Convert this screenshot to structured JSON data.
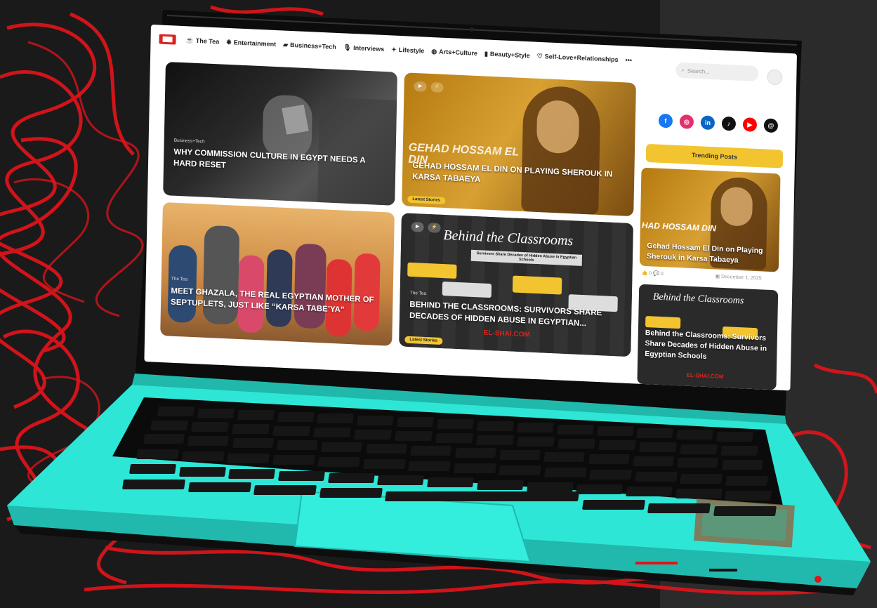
{
  "nav": {
    "items": [
      {
        "icon": "mug-icon",
        "glyph": "☕",
        "label": "The Tea"
      },
      {
        "icon": "theater-icon",
        "glyph": "✱",
        "label": "Entertainment"
      },
      {
        "icon": "briefcase-icon",
        "glyph": "▰",
        "label": "Business+Tech"
      },
      {
        "icon": "microphone-icon",
        "glyph": "🎙",
        "label": "Interviews"
      },
      {
        "icon": "sparkle-icon",
        "glyph": "✦",
        "label": "Lifestyle"
      },
      {
        "icon": "palette-icon",
        "glyph": "◍",
        "label": "Arts+Culture"
      },
      {
        "icon": "lipstick-icon",
        "glyph": "▮",
        "label": "Beauty+Style"
      },
      {
        "icon": "heart-icon",
        "glyph": "♡",
        "label": "Self-Love+Relationships"
      }
    ],
    "more": "•••",
    "search_placeholder": "Search..."
  },
  "cards": {
    "c1": {
      "category": "Business+Tech",
      "title": "WHY COMMISSION CULTURE IN EGYPT NEEDS A HARD RESET"
    },
    "c2": {
      "overlay": "GEHAD HOSSAM EL DIN",
      "title": "GEHAD HOSSAM EL DIN ON PLAYING SHEROUK IN KARSA TABAEYA",
      "tag": "Latest Stories"
    },
    "c3": {
      "category": "The Tea",
      "title": "MEET GHAZALA, THE REAL EGYPTIAN MOTHER OF SEPTUPLETS, JUST LIKE “KARSA TABE’YA”"
    },
    "c4": {
      "poster_title": "Behind the Classrooms",
      "poster_sub": "Survivors Share Decades of Hidden Abuse in Egyptian Schools",
      "category": "The Tea",
      "title": "BEHIND THE CLASSROOMS: SURVIVORS SHARE DECADES OF HIDDEN ABUSE IN EGYPTIAN...",
      "tag": "Latest Stories",
      "brand": "EL-SHAI.COM"
    }
  },
  "sidebar": {
    "socials": [
      {
        "icon": "facebook-icon",
        "glyph": "f",
        "color": "#1877f2"
      },
      {
        "icon": "instagram-icon",
        "glyph": "◎",
        "color": "#e1306c"
      },
      {
        "icon": "linkedin-icon",
        "glyph": "in",
        "color": "#0a66c2"
      },
      {
        "icon": "tiktok-icon",
        "glyph": "♪",
        "color": "#111111"
      },
      {
        "icon": "youtube-icon",
        "glyph": "▶",
        "color": "#ff0000"
      },
      {
        "icon": "threads-icon",
        "glyph": "@",
        "color": "#111111"
      }
    ],
    "trending_label": "Trending Posts",
    "post1": {
      "overlay": "HAD HOSSAM DIN",
      "title": "Gehad Hossam El Din on Playing Sherouk in Karsa Tabaeya",
      "likes": "0",
      "comments": "0",
      "date": "December 1, 2025"
    },
    "post2": {
      "poster_title": "Behind the Classrooms",
      "title": "Behind the Classrooms: Survivors Share Decades of Hidden Abuse in Egyptian Schools",
      "brand": "EL-SHAI.COM"
    }
  },
  "colors": {
    "accent": "#f2c530",
    "laptop_body": "#2ee6d6",
    "brand_red": "#d8251d"
  }
}
